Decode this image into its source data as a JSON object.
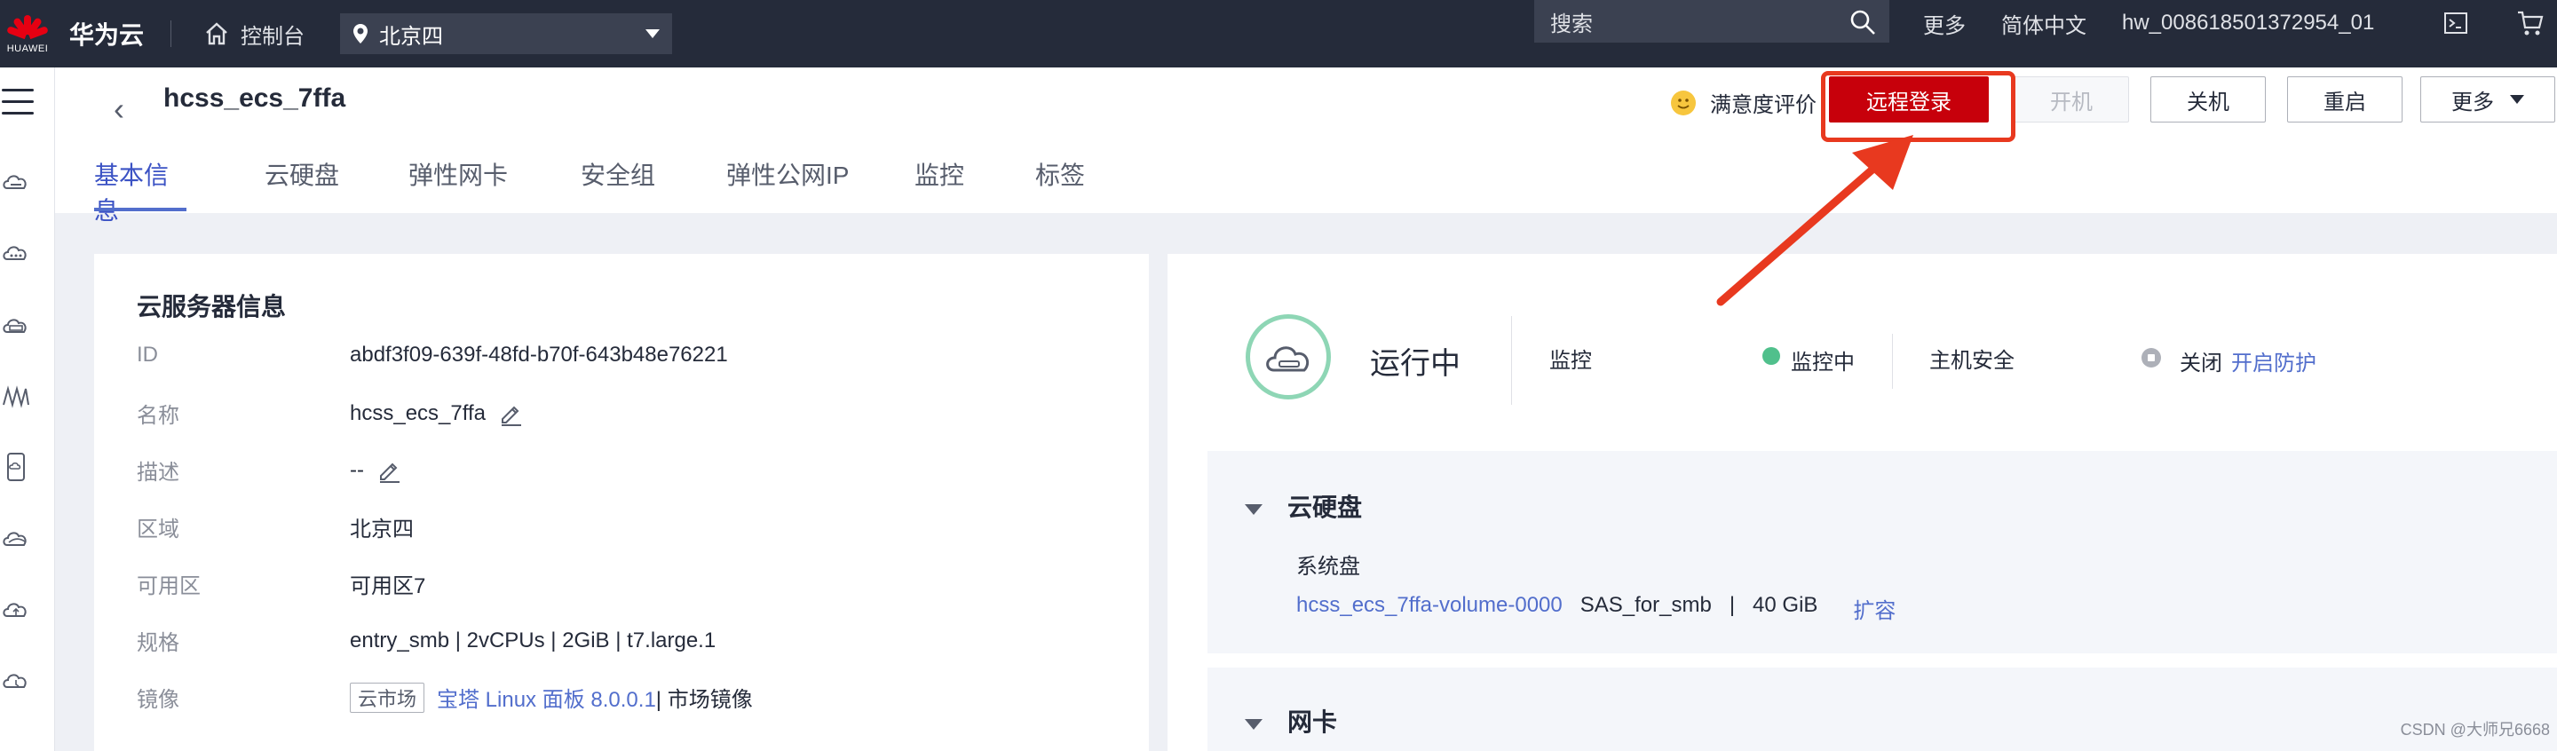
{
  "topbar": {
    "brand": "华为云",
    "logo_text": "HUAWEI",
    "console": "控制台",
    "region": "北京四",
    "search_placeholder": "搜索",
    "more": "更多",
    "language": "简体中文",
    "account": "hw_008618501372954_01"
  },
  "header": {
    "back": "‹",
    "title": "hcss_ecs_7ffa",
    "satisfaction": "满意度评价",
    "buttons": {
      "remote_login": "远程登录",
      "power_on": "开机",
      "power_off": "关机",
      "restart": "重启",
      "more": "更多"
    },
    "tabs": [
      "基本信息",
      "云硬盘",
      "弹性网卡",
      "安全组",
      "弹性公网IP",
      "监控",
      "标签"
    ]
  },
  "server_info": {
    "title": "云服务器信息",
    "rows": [
      {
        "label": "ID",
        "value": "abdf3f09-639f-48fd-b70f-643b48e76221"
      },
      {
        "label": "名称",
        "value": "hcss_ecs_7ffa"
      },
      {
        "label": "描述",
        "value": "--"
      },
      {
        "label": "区域",
        "value": "北京四"
      },
      {
        "label": "可用区",
        "value": "可用区7"
      },
      {
        "label": "规格",
        "value": "entry_smb | 2vCPUs | 2GiB | t7.large.1"
      },
      {
        "label": "镜像",
        "tag": "云市场",
        "link": "宝塔 Linux 面板 8.0.0.1",
        "suffix": " | 市场镜像"
      }
    ]
  },
  "status": {
    "state": "运行中",
    "monitor_label": "监控",
    "monitor_value": "监控中",
    "host_security_label": "主机安全",
    "host_security_value": "关闭",
    "host_security_link": "开启防护"
  },
  "disks": {
    "title": "云硬盘",
    "system_disk_label": "系统盘",
    "volume_name": "hcss_ecs_7ffa-volume-0000",
    "volume_type": "SAS_for_smb",
    "volume_sep": "|",
    "volume_size": "40 GiB",
    "expand": "扩容"
  },
  "nic": {
    "title": "网卡"
  },
  "watermark": "CSDN @大师兄6668",
  "colors": {
    "accent": "#526ecc",
    "primary_button": "#c7000b",
    "highlight": "#e8391f",
    "running": "#50c08c"
  }
}
